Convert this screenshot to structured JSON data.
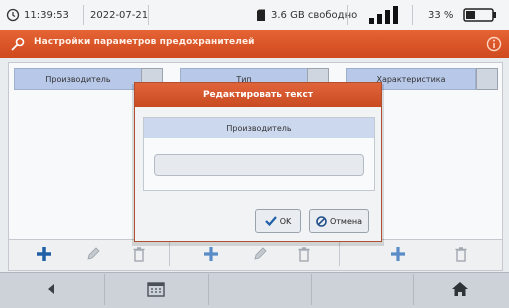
{
  "status_bar": {
    "time": "11:39:53",
    "date": "2022-07-21",
    "storage": "3.6 GB свободно",
    "battery_text": "33 %"
  },
  "app_bar": {
    "title": "Настройки параметров предохранителей"
  },
  "columns": [
    {
      "label": "Производитель"
    },
    {
      "label": "Тип"
    },
    {
      "label": "Характеристика"
    }
  ],
  "dialog": {
    "title": "Редактировать текст",
    "field_label": "Производитель",
    "input_value": "",
    "ok_label": "OK",
    "cancel_label": "Отмена"
  },
  "colors": {
    "accent": "#d9522a",
    "header_blue": "#b8c8e8",
    "add_green": "#2e7d32",
    "add_blue": "#1f5fa8"
  }
}
